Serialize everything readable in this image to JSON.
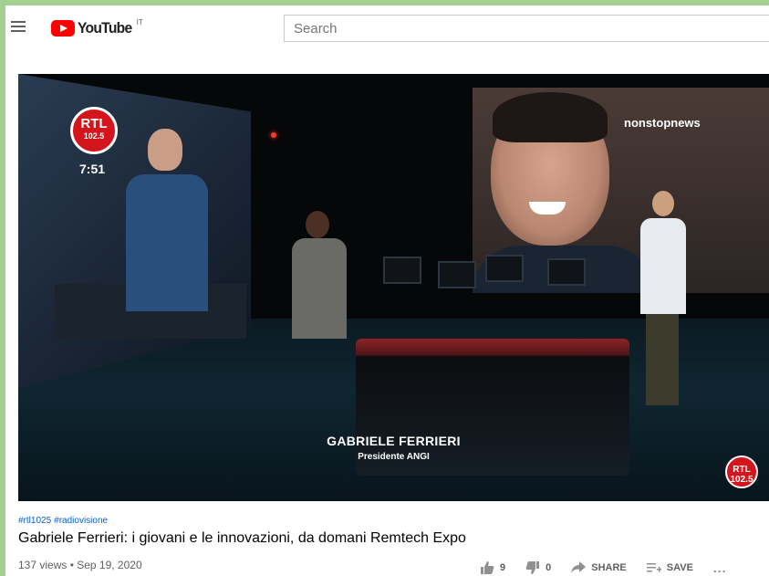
{
  "header": {
    "logo_text": "YouTube",
    "country_code": "IT",
    "search_placeholder": "Search"
  },
  "video": {
    "channel_badge_line1": "RTL",
    "channel_badge_line2": "102.5",
    "clock": "7:51",
    "overlay_brand": "nonstopnews",
    "lower_third_name": "GABRIELE FERRIERI",
    "lower_third_role": "Presidente ANGI",
    "corner_logo_line1": "RTL",
    "corner_logo_line2": "102.5"
  },
  "metadata": {
    "hashtags": [
      "#rtl1025",
      "#radiovisione"
    ],
    "title": "Gabriele Ferrieri: i giovani e le innovazioni, da domani Remtech Expo",
    "views_date": "137 views • Sep 19, 2020"
  },
  "actions": {
    "like_count": "9",
    "dislike_count": "0",
    "share_label": "SHARE",
    "save_label": "SAVE",
    "more_label": "..."
  },
  "icons": {
    "menu": "menu-icon",
    "like": "thumb-up-icon",
    "dislike": "thumb-down-icon",
    "share": "share-icon",
    "save": "save-playlist-icon",
    "more": "more-icon"
  },
  "colors": {
    "accent_link": "#065fd4",
    "youtube_red": "#ff0000",
    "rtl_red": "#d4151b",
    "outer_frame": "#a3cf90"
  }
}
